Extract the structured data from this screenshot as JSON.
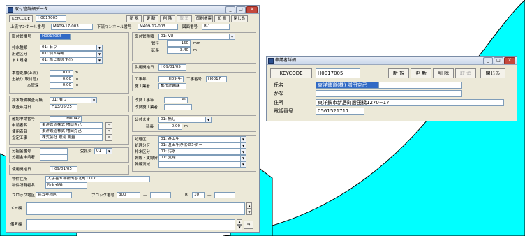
{
  "colors": {
    "cyan_shape": "#00ffff",
    "window_bg": "#ece9d8",
    "selection": "#316ac5",
    "close_button": "#c4483d"
  },
  "win1": {
    "title": "取付管詳細データ",
    "win_buttons": {
      "min": "_",
      "max": "□",
      "close": "X"
    },
    "keycode_label": "KEYCODE",
    "keycode_value": "H0017005",
    "buttons": {
      "new": "新 規",
      "update": "更 新",
      "delete": "削 除",
      "cancel": "取 消",
      "print_list": "印刷帳票",
      "print": "印 刷",
      "close": "閉じる"
    },
    "upper_manhole_label": "上流マンホール番号",
    "upper_manhole": "M409-17-003",
    "lower_manhole_label": "下流マンホール番号",
    "lower_manhole": "M409-17-003",
    "map_no_label": "図面番号",
    "map_no": "B-1",
    "pipe_no_label": "取付管番号",
    "pipe_no": "H0017005",
    "pipe_type_label": "取付管種類",
    "pipe_type": "01: VU",
    "diameter_label": "管径",
    "diameter": "150",
    "diameter_unit": "mm",
    "extension_label": "延長",
    "extension": "3.40",
    "extension_unit": "m",
    "drain_type_label": "排水種類",
    "drain_type": "01: 有り",
    "drain_use_label": "用途区分",
    "drain_use": "01: 個人専用",
    "basin_label": "ます規格",
    "basin": "01: 塩ビ製ます(Ⅰ)",
    "use_start_label": "供用開始日",
    "use_start": "H09/01/05",
    "dist_upper_label": "本管距離(上流)",
    "dist_upper": "0.00",
    "dist_unit": "m",
    "depth_label": "土被り(取付管)",
    "depth": "0.00",
    "depth_main_label": "本管深",
    "depth_main": "0.00",
    "construction_label": "工事年",
    "construction": "H09 年",
    "work_no_label": "工事番号",
    "work_no": "H0017",
    "contractor_label": "施工業者",
    "contractor": "都市計画課",
    "inspection_label": "排水設備検査有無",
    "inspection": "01: 有り",
    "inspection_date_label": "検査年月日",
    "inspection_date": "H13/05/25",
    "renew_year_label": "改良工事年",
    "renew_year": "年",
    "renew_contractor_label": "改良施工業者",
    "renew_contractor": "",
    "application_no_label": "確認申請番号",
    "application_no": "M0042",
    "applicant_label": "申請者名",
    "applicant": "東洋鉄道株式 増田克己",
    "user_label": "使用者名",
    "user": "東洋鉄道株式 増田克己",
    "designer_label": "指定工事",
    "designer": "株式会社 銀河 測量",
    "connection_label": "公共ます",
    "connection": "01: 無し",
    "connection_ext_label": "延長",
    "connection_ext": "0.00",
    "area_label": "処理区",
    "area": "01: 甚五年",
    "zone_label": "処理分区",
    "zone": "01: 甚五年浄化センター",
    "dist_label": "排水区分",
    "dist": "01: 汚水",
    "route_label": "幹線・支線分類",
    "route": "01: 支線",
    "flow_label": "幹線流域",
    "flow": "",
    "sewer_area_label": "分担金番号",
    "sewer_area": "",
    "sewer_applicant_label": "分担金申請者",
    "sewer_applicant": "",
    "share_amount_label": "受払済",
    "share_amount": "01",
    "permit_date_label": "使用開始日",
    "permit_date": "H09/01/05",
    "address_label": "物件住所",
    "address": "大字甚五年新出谷北町1117",
    "owner_label": "物件所有者名",
    "owner": "所有者名",
    "block_label": "ブロック地区",
    "block": "甚五年地区",
    "block_no_label": "ブロック番号",
    "block_no": "300",
    "block_dash": "—",
    "block_to_label": "B",
    "block_to": "10",
    "memo_label": "メモ欄",
    "memo": "",
    "remarks_label": "備考欄",
    "remarks": "",
    "scroll_up": "▲",
    "scroll_down": "▼",
    "jump": "⇒"
  },
  "win2": {
    "title": "申請者詳細",
    "keycode_label": "KEYCODE",
    "keycode_value": "H0017005",
    "buttons": {
      "new": "新 規",
      "update": "更 新",
      "delete": "削 除",
      "cancel": "取 消",
      "close": "閉じる"
    },
    "name_label": "氏名",
    "name": "東洋鉄道(株) 増田克己",
    "kana_label": "かな",
    "kana": "",
    "address_label": "住所",
    "address": "東洋鉄市新居町勝田橋1270−17",
    "phone_label": "電話番号",
    "phone": "0561521717"
  }
}
